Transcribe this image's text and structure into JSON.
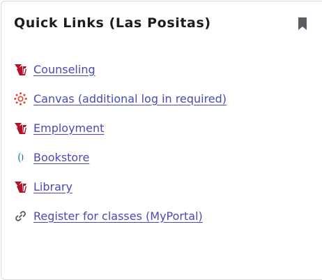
{
  "card": {
    "title": "Quick Links (Las Positas)",
    "bookmark_icon": "bookmark-icon"
  },
  "links": [
    {
      "label": "Counseling",
      "icon": "las-positas-logo-icon"
    },
    {
      "label": "Canvas (additional log in required)",
      "icon": "canvas-logo-icon"
    },
    {
      "label": "Employment",
      "icon": "las-positas-logo-icon"
    },
    {
      "label": "Bookstore",
      "icon": "bookstore-logo-icon"
    },
    {
      "label": "Library",
      "icon": "las-positas-logo-icon"
    },
    {
      "label": "Register for classes (MyPortal)",
      "icon": "link-chain-icon"
    }
  ],
  "colors": {
    "link": "#4a48b8",
    "title": "#1c1c1c",
    "bookmark": "#5c5c66",
    "las_positas_red": "#b1142a",
    "canvas_red": "#e1452f",
    "bookstore_blue": "#1f8fd8"
  }
}
